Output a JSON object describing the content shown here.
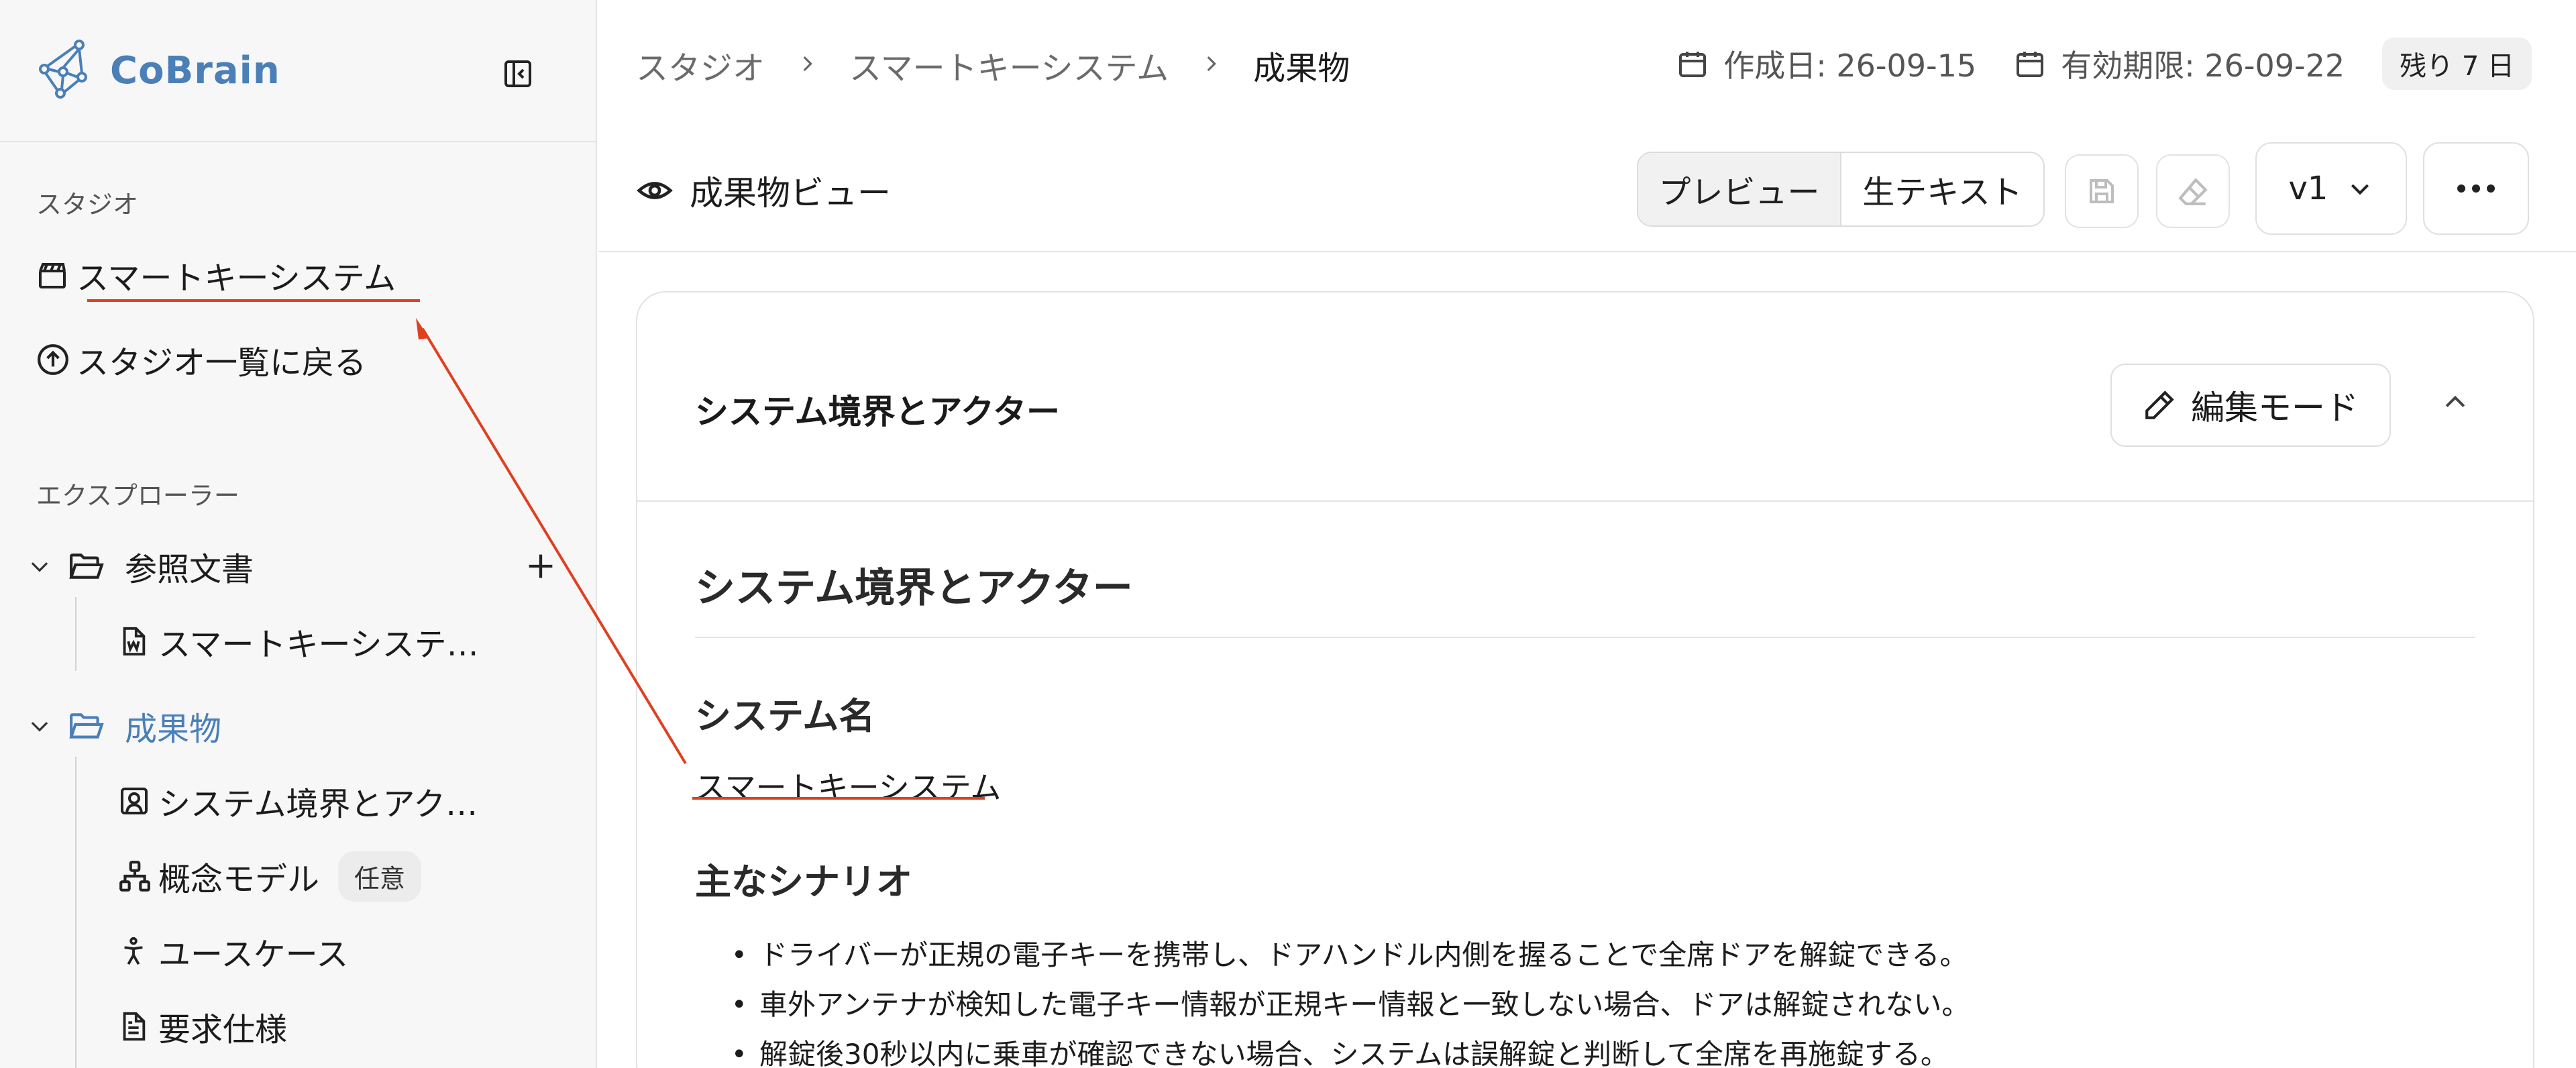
{
  "app": {
    "name": "CoBrain"
  },
  "sidebar": {
    "studio_label": "スタジオ",
    "current_studio": "スマートキーシステム",
    "back_to_list": "スタジオ一覧に戻る",
    "explorer_label": "エクスプローラー",
    "tree": [
      {
        "label": "参照文書",
        "expanded": true,
        "children": [
          {
            "label": "スマートキーシステ…"
          }
        ]
      },
      {
        "label": "成果物",
        "expanded": true,
        "active": true,
        "children": [
          {
            "label": "システム境界とアク…",
            "icon": "user-square-icon"
          },
          {
            "label": "概念モデル",
            "icon": "hierarchy-icon",
            "badge": "任意"
          },
          {
            "label": "ユースケース",
            "icon": "person-icon"
          },
          {
            "label": "要求仕様",
            "icon": "document-icon"
          }
        ]
      }
    ]
  },
  "header": {
    "breadcrumbs": [
      "スタジオ",
      "スマートキーシステム",
      "成果物"
    ],
    "created_label": "作成日: 26-09-15",
    "expires_label": "有効期限: 26-09-22",
    "remaining": "残り 7 日"
  },
  "toolbar": {
    "view_title": "成果物ビュー",
    "preview_label": "プレビュー",
    "raw_label": "生テキスト",
    "version": "v1"
  },
  "card": {
    "title": "システム境界とアクター",
    "edit_label": "編集モード",
    "doc_title": "システム境界とアクター",
    "system_name_heading": "システム名",
    "system_name": "スマートキーシステム",
    "scenario_heading": "主なシナリオ",
    "scenarios": [
      "ドライバーが正規の電子キーを携帯し、ドアハンドル内側を握ることで全席ドアを解錠できる。",
      "車外アンテナが検知した電子キー情報が正規キー情報と一致しない場合、ドアは解錠されない。",
      "解錠後30秒以内に乗車が確認できない場合、システムは誤解錠と判断して全席を再施錠する。"
    ]
  },
  "colors": {
    "accent": "#4a7fb8",
    "annotation": "#e0401f"
  }
}
